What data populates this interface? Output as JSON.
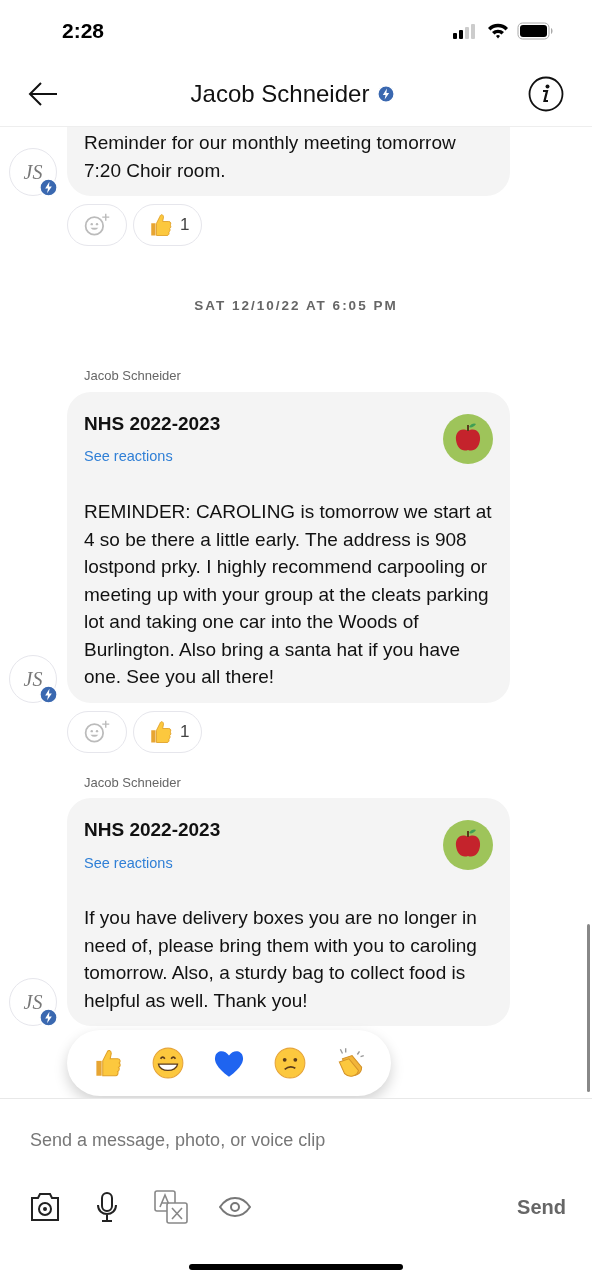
{
  "status_bar": {
    "time": "2:28"
  },
  "header": {
    "title": "Jacob Schneider",
    "verified": true
  },
  "thread": [
    {
      "kind": "message",
      "cut_top": true,
      "text": "Reminder for our monthly meeting tomorrow 7:20 Choir room.",
      "avatar": "JS",
      "verified": true,
      "reactions": [
        {
          "kind": "add"
        },
        {
          "kind": "thumbs_up",
          "count": "1"
        }
      ]
    },
    {
      "kind": "date",
      "text": "SAT 12/10/22 AT 6:05 PM"
    },
    {
      "kind": "message",
      "cut_top": false,
      "sender": "Jacob Schneider",
      "title": "NHS 2022-2023",
      "link": "See reactions",
      "group_avatar": true,
      "text": "REMINDER: CAROLING is tomorrow we start at 4 so be there a little early. The address is 908 lostpond prky. I highly recommend carpooling or meeting up with your group at the cleats parking lot and taking one car into the Woods of Burlington. Also bring a santa hat if you have one. See you all there!",
      "avatar": "JS",
      "verified": true,
      "reactions": [
        {
          "kind": "add"
        },
        {
          "kind": "thumbs_up",
          "count": "1"
        }
      ]
    },
    {
      "kind": "message",
      "cut_top": false,
      "sender": "Jacob Schneider",
      "title": "NHS 2022-2023",
      "link": "See reactions",
      "group_avatar": true,
      "text": "If you have delivery boxes you are no longer in need of, please bring them with you to caroling tomorrow. Also, a sturdy bag to collect food is helpful as well. Thank you!",
      "avatar": "JS",
      "verified": true,
      "reaction_picker": [
        {
          "kind": "thumbs_up"
        },
        {
          "kind": "grin"
        },
        {
          "kind": "heart"
        },
        {
          "kind": "confused"
        },
        {
          "kind": "clap"
        }
      ]
    }
  ],
  "composer": {
    "placeholder": "Send a message, photo, or voice clip",
    "send": "Send"
  }
}
